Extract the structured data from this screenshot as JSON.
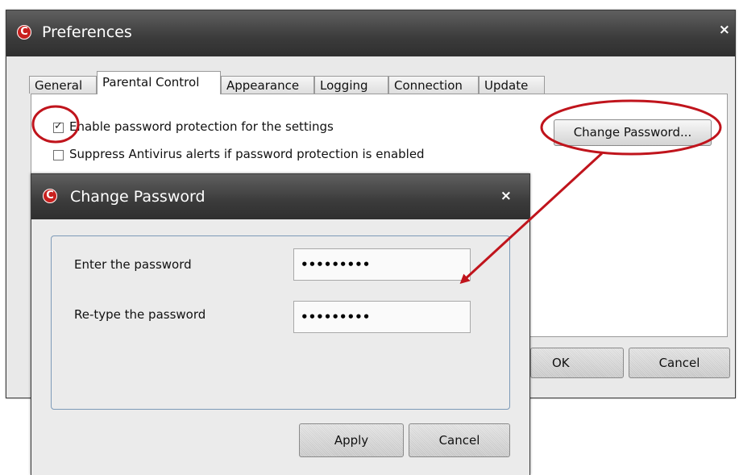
{
  "prefs_window": {
    "title": "Preferences",
    "logo_letter": "C",
    "close_glyph": "×",
    "tabs": [
      {
        "label": "General",
        "active": false
      },
      {
        "label": "Parental Control",
        "active": true
      },
      {
        "label": "Appearance",
        "active": false
      },
      {
        "label": "Logging",
        "active": false
      },
      {
        "label": "Connection",
        "active": false
      },
      {
        "label": "Update",
        "active": false
      }
    ],
    "checkboxes": [
      {
        "label": "Enable password protection for the settings",
        "checked": true
      },
      {
        "label": "Suppress Antivirus alerts if password protection is enabled",
        "checked": false
      }
    ],
    "change_password_button": "Change Password...",
    "ok_button": "OK",
    "cancel_button": "Cancel"
  },
  "change_password_dialog": {
    "title": "Change Password",
    "logo_letter": "C",
    "close_glyph": "×",
    "fields": [
      {
        "label": "Enter the password",
        "value": "•••••••••"
      },
      {
        "label": "Re-type the password",
        "value": "•••••••••"
      }
    ],
    "apply_button": "Apply",
    "cancel_button": "Cancel"
  },
  "colors": {
    "annotation_red": "#c0141c",
    "titlebar": "#3b3b3b",
    "brand_red": "#c8201e"
  }
}
